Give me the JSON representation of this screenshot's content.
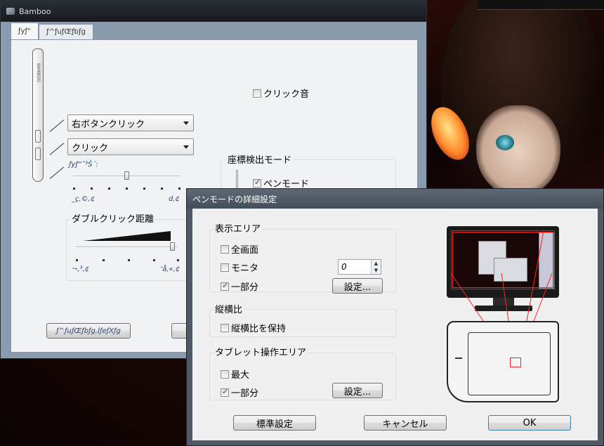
{
  "main_window": {
    "title": "Bamboo",
    "tabs": [
      "ƒyƒ“",
      "ƒ^ƒuƒŒƒbƒg"
    ],
    "click_sound_label": "クリック音",
    "dropdown_upper": "右ボタンクリック",
    "dropdown_lower": "クリック",
    "pen_pressure_label": "ƒyƒ“ˆ³Š´:",
    "pressure_low": "_ç‚©‚¢",
    "pressure_high": "d‚¢",
    "double_click_label": "ダブルクリック距離",
    "dc_low": "¬‚³‚¢",
    "dc_high": "‘å‚«‚¢",
    "coord_mode_label": "座標検出モード",
    "pen_mode_label": "ペンモード",
    "tablet_test_button": "ƒ^ƒuƒŒƒbƒg‚ÌƒeƒXƒg"
  },
  "dialog": {
    "title": "ペンモードの詳細設定",
    "display_area": {
      "label": "表示エリア",
      "fullscreen": "全画面",
      "monitor": "モニタ",
      "monitor_value": "0",
      "portion": "一部分",
      "settings_button": "設定..."
    },
    "aspect": {
      "label": "縦横比",
      "keep": "縦横比を保持"
    },
    "tablet_area": {
      "label": "タブレット操作エリア",
      "max": "最大",
      "portion": "一部分",
      "settings_button": "設定..."
    },
    "buttons": {
      "default": "標準設定",
      "cancel": "キャンセル",
      "ok": "OK"
    }
  },
  "colors": {
    "accent_red": "#ff2222",
    "title_dark": "#16191e",
    "panel": "#f0f2f4"
  },
  "pen_pressure_level": 0.5,
  "double_click_level": 0.95
}
